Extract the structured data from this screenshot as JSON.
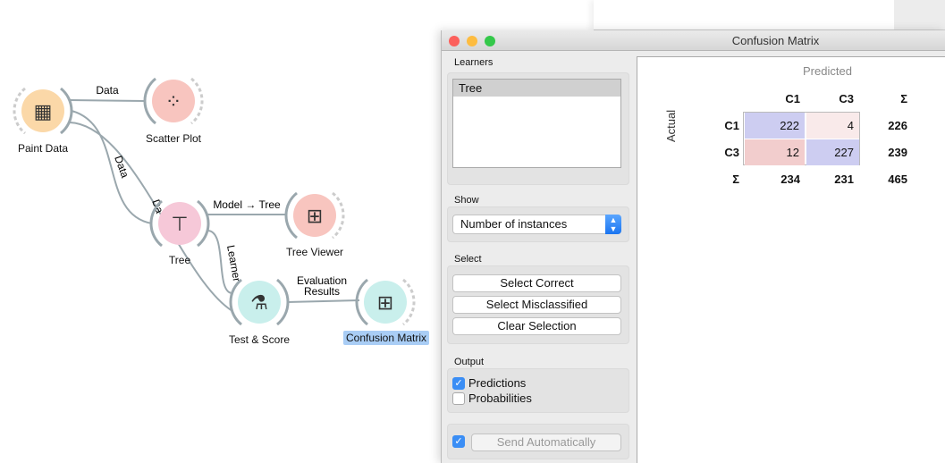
{
  "canvas": {
    "nodes": [
      {
        "label": "Paint Data",
        "icon": "paint-data-icon",
        "color": "#fbd8a8"
      },
      {
        "label": "Scatter Plot",
        "icon": "scatter-plot-icon",
        "color": "#f8c5bf"
      },
      {
        "label": "Tree",
        "icon": "tree-icon",
        "color": "#f6c8d8"
      },
      {
        "label": "Tree Viewer",
        "icon": "tree-viewer-icon",
        "color": "#f8c5bf"
      },
      {
        "label": "Test & Score",
        "icon": "test-score-icon",
        "color": "#c9efec"
      },
      {
        "label": "Confusion Matrix",
        "icon": "confusion-matrix-icon",
        "color": "#c9efec"
      }
    ],
    "links": {
      "data1": "Data",
      "data2": "Data",
      "data3": "Da",
      "model": "Model → Tree",
      "learner": "Learner",
      "eval1": "Evaluation",
      "eval2": "Results"
    }
  },
  "window": {
    "title": "Confusion Matrix",
    "learners": {
      "title": "Learners",
      "items": [
        "Tree"
      ]
    },
    "show": {
      "title": "Show",
      "selected": "Number of instances"
    },
    "select": {
      "title": "Select",
      "buttons": [
        "Select Correct",
        "Select Misclassified",
        "Clear Selection"
      ]
    },
    "output": {
      "title": "Output",
      "predictions": "Predictions",
      "predictions_checked": true,
      "probabilities": "Probabilities",
      "probabilities_checked": false
    },
    "send": {
      "label": "Send Automatically",
      "checked": true
    }
  },
  "matrix": {
    "predicted_label": "Predicted",
    "actual_label": "Actual",
    "sum_symbol": "Σ",
    "classes": [
      "C1",
      "C3"
    ],
    "cells": [
      [
        "222",
        "4"
      ],
      [
        "12",
        "227"
      ]
    ],
    "row_sums": [
      "226",
      "239"
    ],
    "col_sums": [
      "234",
      "231"
    ],
    "total": "465",
    "colors": {
      "correct": "#cdcdf1",
      "minor_error": "#f9eaea",
      "error": "#f2cdcd"
    }
  }
}
